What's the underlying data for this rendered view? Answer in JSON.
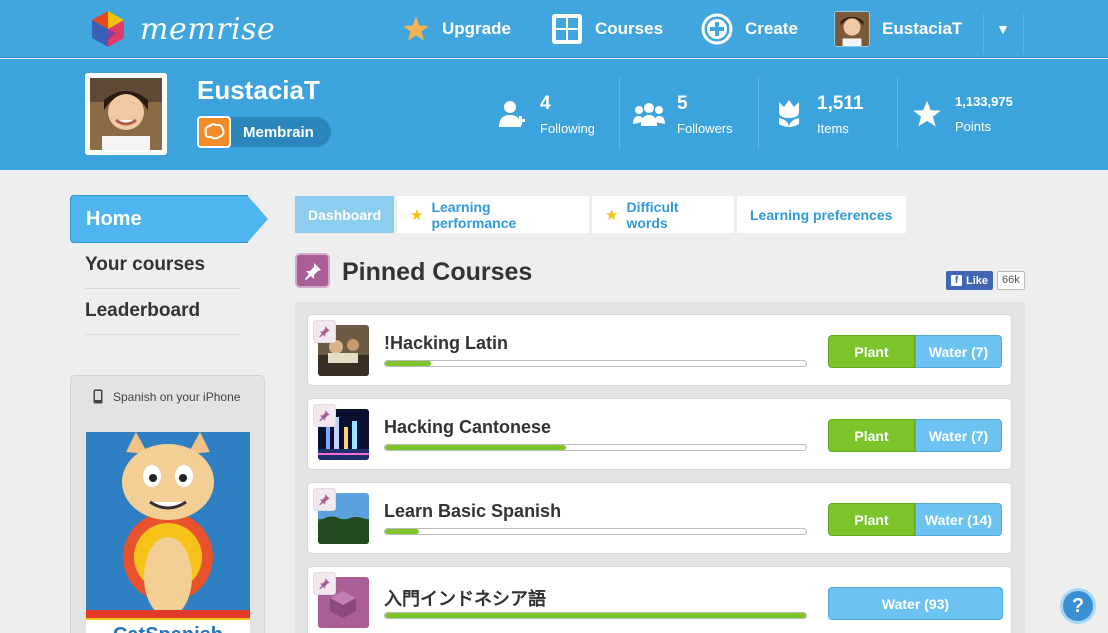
{
  "app": {
    "brand": "memrise"
  },
  "nav": {
    "upgrade": "Upgrade",
    "courses": "Courses",
    "create": "Create",
    "username": "EustaciaT"
  },
  "profile": {
    "name": "EustaciaT",
    "badge": "Membrain",
    "stats": [
      {
        "value": "4",
        "label": "Following"
      },
      {
        "value": "5",
        "label": "Followers"
      },
      {
        "value": "1,511",
        "label": "Items"
      },
      {
        "value": "1,133,975",
        "label": "Points"
      }
    ]
  },
  "sidebar": {
    "home": "Home",
    "items": [
      "Your courses",
      "Leaderboard"
    ],
    "iphone_label": "Spanish on your iPhone",
    "ad_text": "CatSpanish"
  },
  "tabs": [
    "Dashboard",
    "Learning performance",
    "Difficult words",
    "Learning preferences"
  ],
  "pinned": {
    "title": "Pinned Courses",
    "fb_like": "Like",
    "fb_count": "66k",
    "courses": [
      {
        "name": "!Hacking Latin",
        "progress": 0.11,
        "plant": "Plant",
        "water": "Water (7)"
      },
      {
        "name": "Hacking Cantonese",
        "progress": 0.43,
        "plant": "Plant",
        "water": "Water (7)"
      },
      {
        "name": "Learn Basic Spanish",
        "progress": 0.08,
        "plant": "Plant",
        "water": "Water (14)"
      },
      {
        "name": "入門インドネシア語",
        "progress": 1.0,
        "plant": "",
        "water": "Water (93)"
      }
    ]
  },
  "help": "?",
  "colors": {
    "brand_blue": "#40a6dd",
    "plant_green": "#7bc42a",
    "water_blue": "#6cc3f2",
    "pin_purple": "#a95e96"
  }
}
